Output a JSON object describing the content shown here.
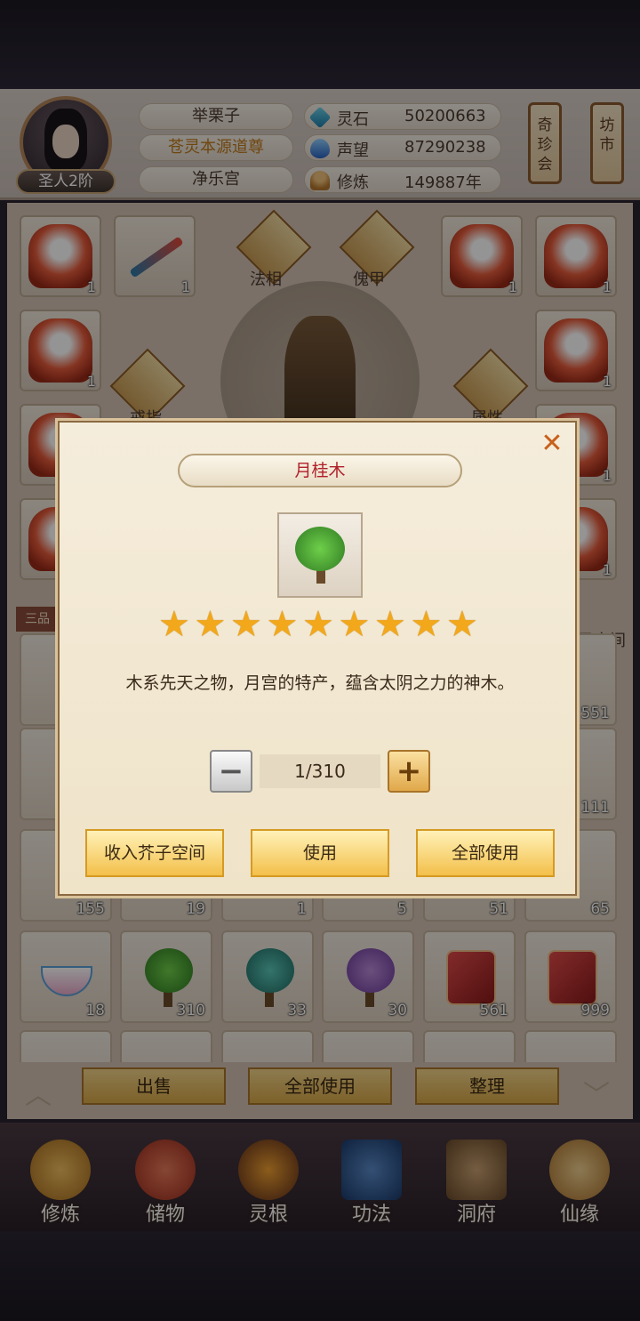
{
  "header": {
    "player_name": "举栗子",
    "title": "苍灵本源道尊",
    "sect": "净乐宫",
    "rank": "圣人2阶",
    "stats": [
      {
        "icon": "lingshi-icon",
        "label": "灵石",
        "value": "50200663"
      },
      {
        "icon": "shengwang-icon",
        "label": "声望",
        "value": "87290238"
      },
      {
        "icon": "xiulian-icon",
        "label": "修炼",
        "value": "149887年"
      }
    ],
    "scrolls": [
      "奇珍会",
      "坊市"
    ]
  },
  "equipment": {
    "labels": {
      "faxiang": "法相",
      "kuijia": "傀甲",
      "jiezhi": "戒指",
      "shuxing": "属性"
    },
    "slot_counts": [
      "1",
      "1",
      "1",
      "1",
      "1",
      "1",
      "1",
      "1",
      "1"
    ],
    "tab_label": "三品",
    "space_label": "子空间"
  },
  "inventory": {
    "row_partial_counts": [
      "551",
      "111"
    ],
    "row3_counts": [
      "155",
      "19",
      "1",
      "5",
      "51",
      "65"
    ],
    "row4": [
      {
        "icon": "teacup-icon",
        "count": "18"
      },
      {
        "icon": "green-tree-icon",
        "count": "310"
      },
      {
        "icon": "teal-tree-icon",
        "count": "33"
      },
      {
        "icon": "purple-tree-icon",
        "count": "30"
      },
      {
        "icon": "red-book-icon",
        "count": "561"
      },
      {
        "icon": "red-book-icon",
        "count": "999"
      }
    ]
  },
  "actions": {
    "sell": "出售",
    "use_all": "全部使用",
    "sort": "整理"
  },
  "nav": [
    {
      "icon": "cultivate-icon",
      "label": "修炼"
    },
    {
      "icon": "storage-icon",
      "label": "储物"
    },
    {
      "icon": "root-icon",
      "label": "灵根"
    },
    {
      "icon": "technique-icon",
      "label": "功法"
    },
    {
      "icon": "cave-icon",
      "label": "洞府"
    },
    {
      "icon": "fate-icon",
      "label": "仙缘"
    }
  ],
  "dialog": {
    "title": "月桂木",
    "star_count": 9,
    "star_glyph": "★",
    "description": "木系先天之物，月宫的特产，蕴含太阴之力的神木。",
    "quantity": "1/310",
    "minus": "−",
    "plus": "+",
    "close": "✕",
    "buttons": {
      "store": "收入芥子空间",
      "use": "使用",
      "use_all": "全部使用"
    }
  }
}
